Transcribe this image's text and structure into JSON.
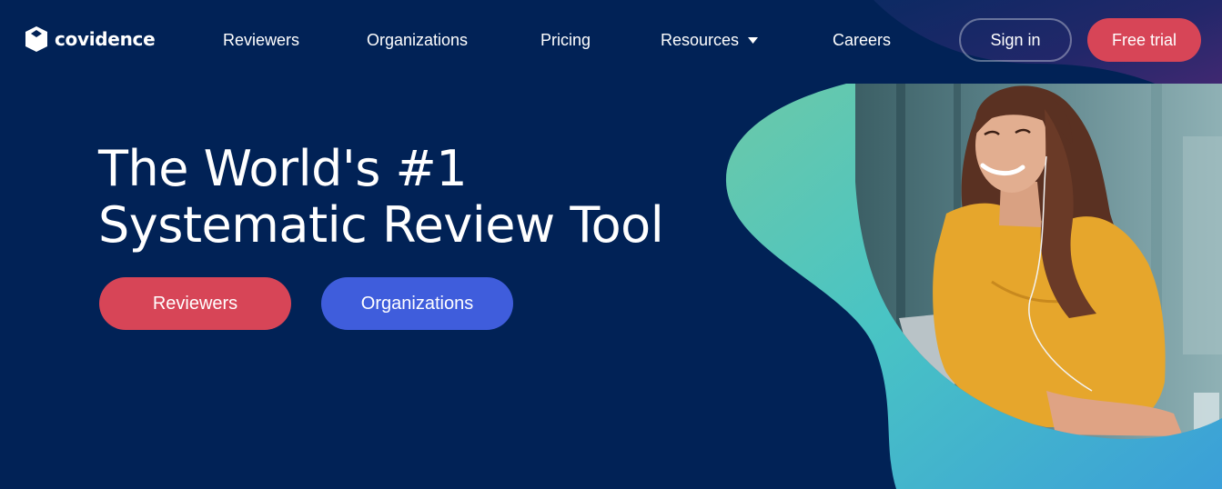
{
  "brand": {
    "logo_text": "covidence",
    "logo_icon": "covidence-shield-icon"
  },
  "nav": {
    "items": [
      {
        "label": "Reviewers"
      },
      {
        "label": "Organizations"
      },
      {
        "label": "Pricing"
      },
      {
        "label": "Resources",
        "icon": "chevron-down-icon"
      },
      {
        "label": "Careers"
      }
    ],
    "sign_in": "Sign in",
    "free_trial": "Free trial"
  },
  "hero": {
    "title_line1": "The World's #1",
    "title_line2": "Systematic Review Tool",
    "cta_primary": "Reviewers",
    "cta_secondary": "Organizations",
    "image": "woman-with-earphones-at-laptop-photo"
  },
  "colors": {
    "background": "#012256",
    "primary_red": "#d74557",
    "secondary_blue": "#3f5ddc",
    "teal_blob": "#4fc3bd",
    "purple_accent": "#8e2f8e",
    "shirt_yellow": "#e6a62c"
  }
}
